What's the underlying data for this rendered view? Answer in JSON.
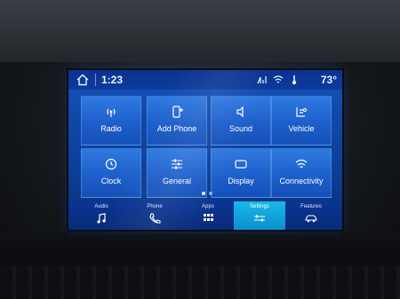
{
  "status": {
    "time": "1:23",
    "temperature": "73°"
  },
  "tiles": [
    {
      "label": "Radio",
      "icon": "radio-icon"
    },
    {
      "label": "Add Phone",
      "icon": "add-phone-icon"
    },
    {
      "label": "Sound",
      "icon": "speaker-icon"
    },
    {
      "label": "Vehicle",
      "icon": "vehicle-icon"
    },
    {
      "label": "Clock",
      "icon": "clock-icon"
    },
    {
      "label": "General",
      "icon": "sliders-icon"
    },
    {
      "label": "Display",
      "icon": "display-icon"
    },
    {
      "label": "Connectivity",
      "icon": "wifi-icon"
    }
  ],
  "nav": [
    {
      "label": "Audio",
      "icon": "music-note-icon"
    },
    {
      "label": "Phone",
      "icon": "phone-icon"
    },
    {
      "label": "Apps",
      "icon": "apps-grid-icon"
    },
    {
      "label": "Settings",
      "icon": "settings-icon",
      "active": true
    },
    {
      "label": "Features",
      "icon": "car-icon"
    }
  ],
  "colors": {
    "screen": "#1452b8",
    "tile": "#2f7ae0",
    "active_tab": "#19b8e8",
    "text": "#ffffff"
  }
}
